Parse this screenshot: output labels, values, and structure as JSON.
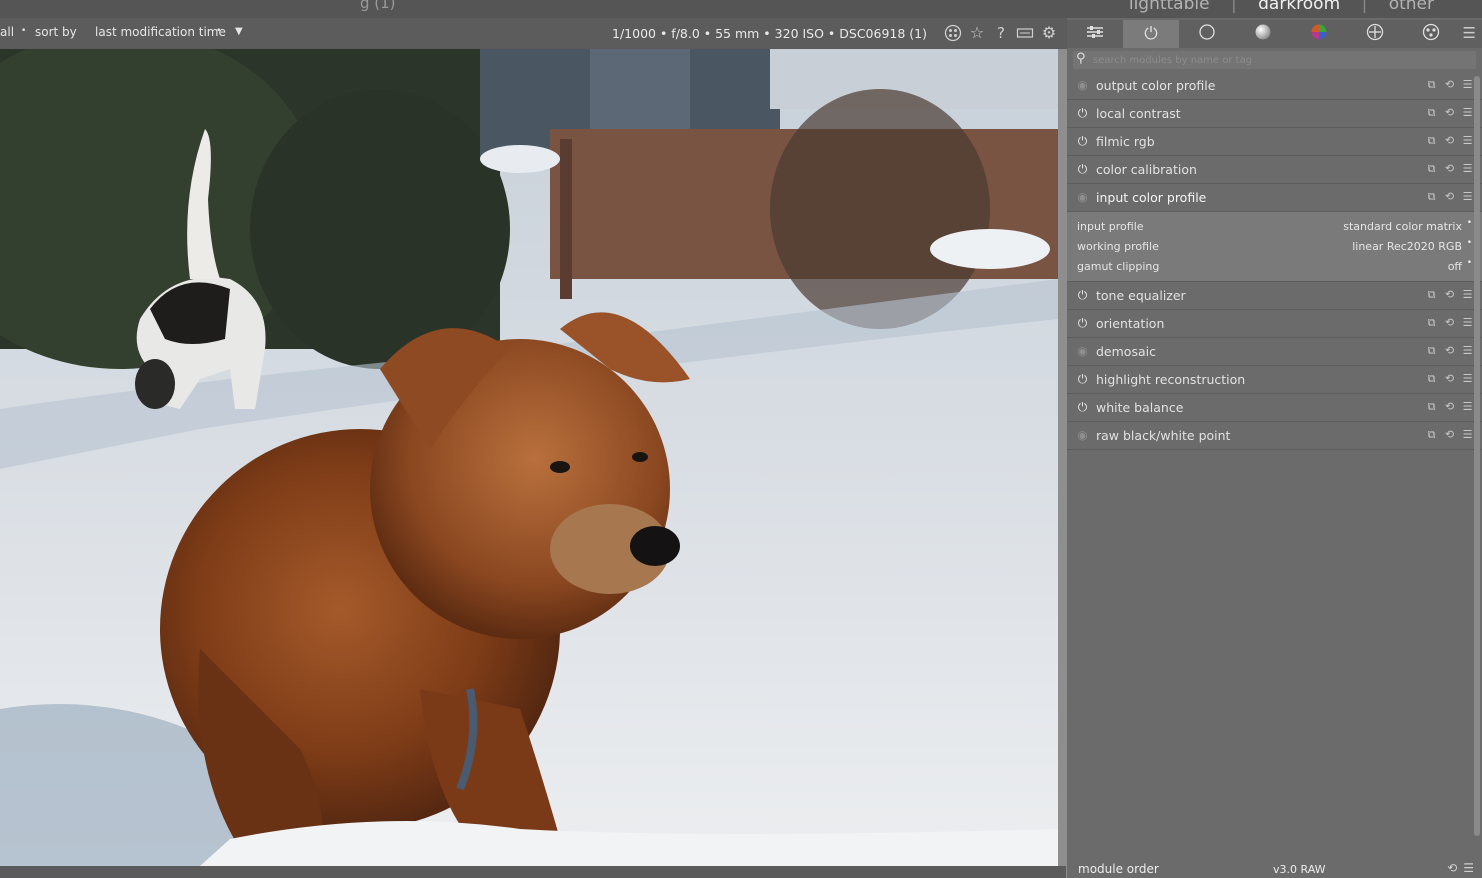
{
  "header": {
    "fragment": "g (1)",
    "views": [
      {
        "label": "lighttable",
        "active": false
      },
      {
        "label": "darkroom",
        "active": true
      },
      {
        "label": "other",
        "active": false
      }
    ]
  },
  "toolbar": {
    "filter_all": "all",
    "sort_by_label": "sort by",
    "sort_value": "last modification time",
    "exif": "1/1000 • f/8.0 • 55 mm • 320 ISO • DSC06918 (1)"
  },
  "icons": {
    "toolbar": [
      "grouping-icon",
      "star-icon",
      "help-icon",
      "shortcuts-icon",
      "gear-icon"
    ],
    "tabs": [
      "sliders-icon",
      "power-icon",
      "circle-icon",
      "sphere-icon",
      "color-wheel-icon",
      "correct-icon",
      "effect-icon"
    ]
  },
  "search": {
    "placeholder": "search modules by name or tag"
  },
  "modules": [
    {
      "name": "output color profile",
      "enabled": false,
      "always_on": true
    },
    {
      "name": "local contrast",
      "enabled": true
    },
    {
      "name": "filmic rgb",
      "enabled": true
    },
    {
      "name": "color calibration",
      "enabled": true
    },
    {
      "name": "input color profile",
      "enabled": false,
      "always_on": true,
      "expanded": true,
      "params": [
        {
          "label": "input profile",
          "value": "standard color matrix"
        },
        {
          "label": "working profile",
          "value": "linear Rec2020 RGB"
        },
        {
          "label": "gamut clipping",
          "value": "off"
        }
      ]
    },
    {
      "name": "tone equalizer",
      "enabled": true
    },
    {
      "name": "orientation",
      "enabled": true
    },
    {
      "name": "demosaic",
      "enabled": false,
      "always_on": true
    },
    {
      "name": "highlight reconstruction",
      "enabled": true
    },
    {
      "name": "white balance",
      "enabled": true
    },
    {
      "name": "raw black/white point",
      "enabled": false,
      "always_on": true
    }
  ],
  "footer": {
    "module_order_label": "module order",
    "module_order_value": "v3.0 RAW"
  },
  "colors": {
    "panel_bg": "#6b6b6b",
    "active_tab": "#7b7b7b",
    "expanded_bg": "#7a7a7a"
  }
}
